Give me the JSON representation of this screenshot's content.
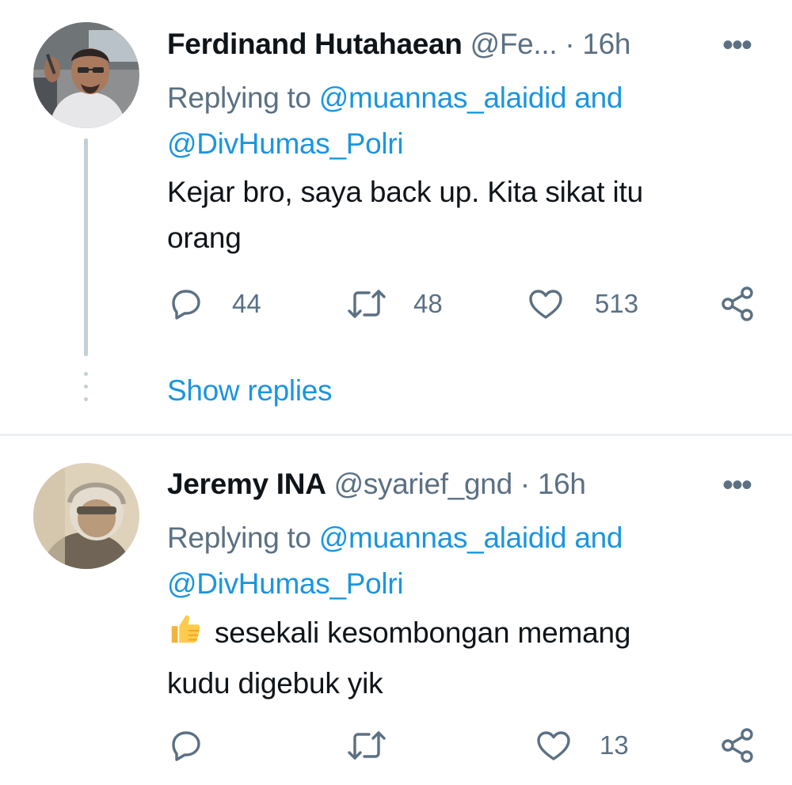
{
  "tweets": [
    {
      "name": "Ferdinand Hutahaean",
      "handle": "@Fe...",
      "separator": "·",
      "time": "16h",
      "more": "•••",
      "replying_prefix": "Replying to",
      "mention1": "@muannas_alaidid",
      "conj": "and",
      "mention2": "@DivHumas_Polri",
      "text_line1": "Kejar bro, saya back up. Kita sikat itu",
      "text_line2": "orang",
      "replies": "44",
      "retweets": "48",
      "likes": "513",
      "show_replies": "Show replies"
    },
    {
      "name": "Jeremy INA",
      "handle": "@syarief_gnd",
      "separator": "·",
      "time": "16h",
      "more": "•••",
      "replying_prefix": "Replying to",
      "mention1": "@muannas_alaidid",
      "conj": "and",
      "mention2": "@DivHumas_Polri",
      "text_line1": "sesekali kesombongan memang",
      "text_line2": "kudu digebuk yik",
      "emoji": "thumbs-up",
      "replies": "",
      "retweets": "",
      "likes": "13"
    }
  ],
  "colors": {
    "text": "#0f1419",
    "secondary": "#5b7083",
    "link": "#1b95e0",
    "thread": "#c4cfd6",
    "divider": "#eceff1"
  },
  "icons": [
    "reply-icon",
    "retweet-icon",
    "like-icon",
    "share-icon",
    "more-icon"
  ]
}
